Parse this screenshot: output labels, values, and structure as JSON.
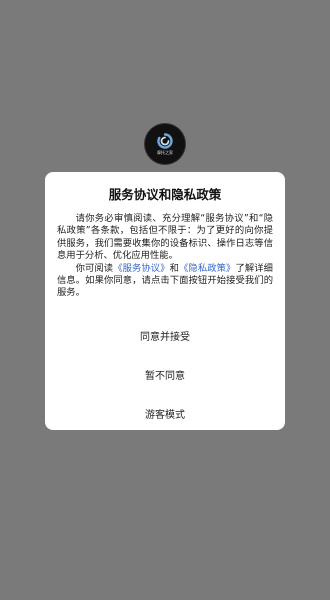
{
  "app": {
    "logo_icon": "app-logo-icon",
    "logo_text": "摩托之家"
  },
  "dialog": {
    "title": "服务协议和隐私政策",
    "paragraph1": "请你务必审慎阅读、充分理解“服务协议”和“隐私政策”各条款，包括但不限于：为了更好的向你提供服务，我们需要收集你的设备标识、操作日志等信息用于分析、优化应用性能。",
    "p2_prefix": "你可阅读",
    "service_link": "《服务协议》",
    "p2_and": "和",
    "privacy_link": "《隐私政策》",
    "p2_suffix": "了解详细信息。如果你同意，请点击下面按钮开始接受我们的服务。",
    "buttons": {
      "agree": "同意并接受",
      "disagree": "暂不同意",
      "guest": "游客模式"
    }
  },
  "colors": {
    "overlay": "#7a7a7a",
    "dialog_bg": "#ffffff",
    "link": "#3366cc"
  }
}
